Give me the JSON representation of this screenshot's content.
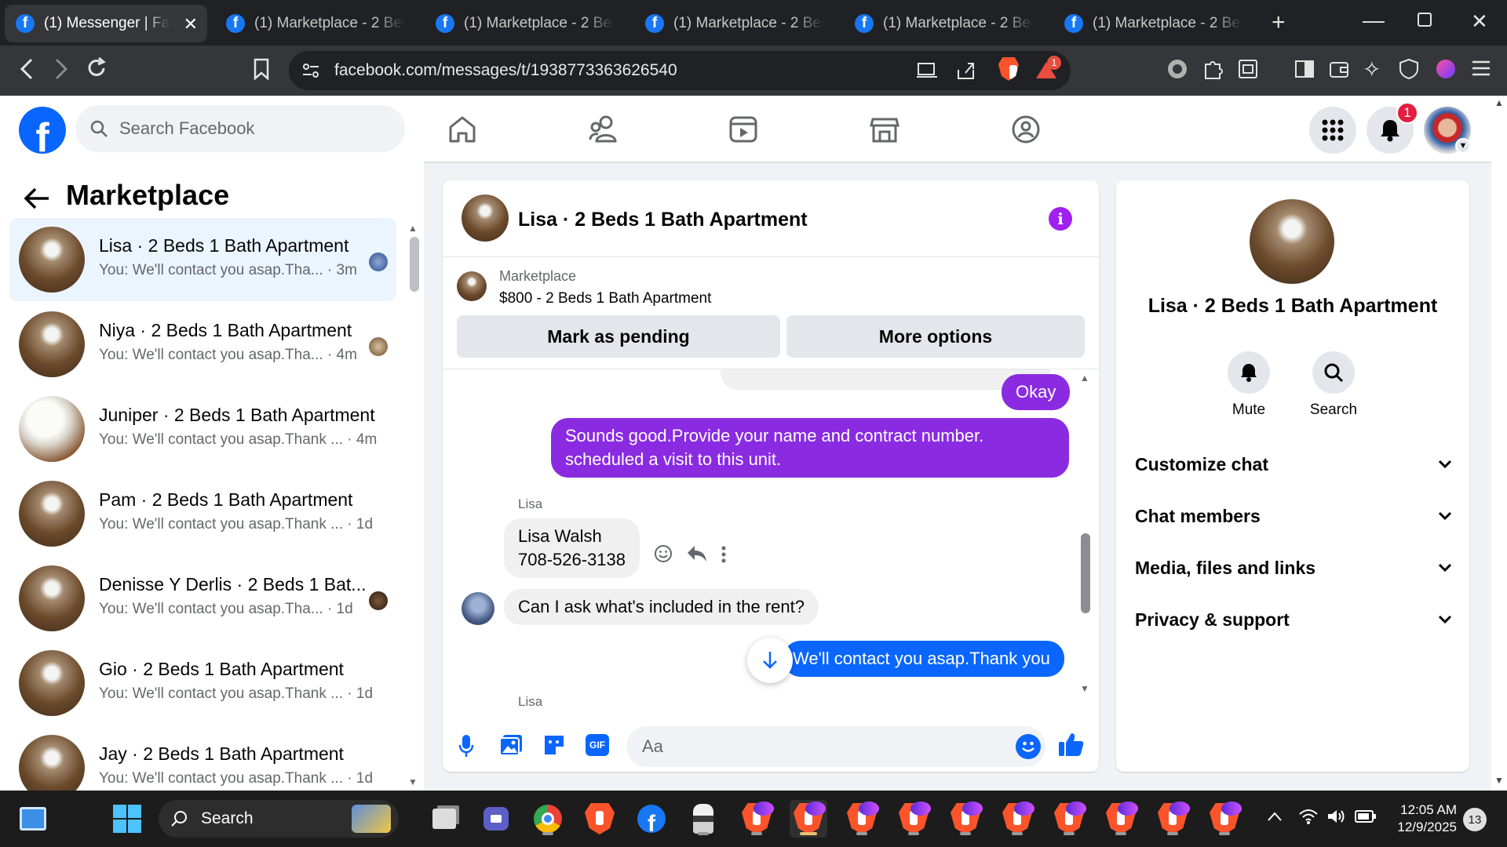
{
  "browser": {
    "tabs": [
      {
        "title": "(1) Messenger | Facebook",
        "active": true
      },
      {
        "title": "(1) Marketplace - 2 Beds",
        "active": false
      },
      {
        "title": "(1) Marketplace - 2 Beds",
        "active": false
      },
      {
        "title": "(1) Marketplace - 2 Beds",
        "active": false
      },
      {
        "title": "(1) Marketplace - 2 Beds",
        "active": false
      },
      {
        "title": "(1) Marketplace - 2 Beds",
        "active": false
      }
    ],
    "url": "facebook.com/messages/t/1938773363626540",
    "alert_badge": "1"
  },
  "fb_header": {
    "search_placeholder": "Search Facebook",
    "notification_count": "1"
  },
  "left_panel": {
    "title": "Marketplace",
    "conversations": [
      {
        "name": "Lisa · 2 Beds 1 Bath Apartment",
        "preview": "You: We'll contact you asap.Tha...",
        "time": "· 3m",
        "selected": true
      },
      {
        "name": "Niya · 2 Beds 1 Bath Apartment",
        "preview": "You: We'll contact you asap.Tha...",
        "time": "· 4m",
        "selected": false
      },
      {
        "name": "Juniper · 2 Beds 1 Bath Apartment",
        "preview": "You: We'll contact you asap.Thank ...",
        "time": "· 4m",
        "selected": false
      },
      {
        "name": "Pam · 2 Beds 1 Bath Apartment",
        "preview": "You: We'll contact you asap.Thank ...",
        "time": "· 1d",
        "selected": false
      },
      {
        "name": "Denisse Y Derlis · 2 Beds 1 Bat...",
        "preview": "You: We'll contact you asap.Tha...",
        "time": "· 1d",
        "selected": false
      },
      {
        "name": "Gio · 2 Beds 1 Bath Apartment",
        "preview": "You: We'll contact you asap.Thank ...",
        "time": "· 1d",
        "selected": false
      },
      {
        "name": "Jay · 2 Beds 1 Bath Apartment",
        "preview": "You: We'll contact you asap.Thank ...",
        "time": "· 1d",
        "selected": false
      }
    ]
  },
  "chat": {
    "title": "Lisa · 2 Beds 1 Bath Apartment",
    "marketplace_label": "Marketplace",
    "listing": "$800 - 2 Beds 1 Bath Apartment",
    "mark_pending_label": "Mark as pending",
    "more_options_label": "More options",
    "messages": {
      "okay": "Okay",
      "sounds_good_1": "Sounds good.Provide your name and contract number.",
      "sounds_good_2": "scheduled a visit to this unit.",
      "sender": "Lisa",
      "lisa_name": "Lisa Walsh",
      "lisa_phone": "708-526-3138",
      "question": "Can I ask what's included in the rent?",
      "reply": "We'll contact you asap.Thank you",
      "next_sender_partial": "Lisa"
    },
    "composer_placeholder": "Aa"
  },
  "right_panel": {
    "name": "Lisa · 2 Beds 1 Bath Apartment",
    "mute_label": "Mute",
    "search_label": "Search",
    "sections": [
      "Customize chat",
      "Chat members",
      "Media, files and links",
      "Privacy & support"
    ]
  },
  "taskbar": {
    "search_label": "Search",
    "time": "12:05 AM",
    "date": "12/9/2025",
    "notification_count": "13"
  },
  "colors": {
    "fb_blue": "#0866ff",
    "chat_purple": "#8a2be2",
    "reply_blue": "#0a66ff",
    "selected_row": "#ebf5ff"
  }
}
